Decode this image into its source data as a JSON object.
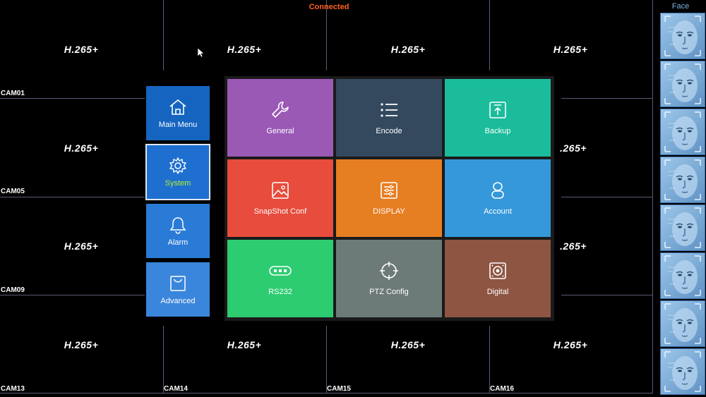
{
  "status": {
    "connection": "Connected"
  },
  "codec_label": "H.265+",
  "codec_label_partial": ".265+",
  "cameras": [
    "CAM01",
    "CAM05",
    "CAM09",
    "CAM13",
    "CAM14",
    "CAM15",
    "CAM16"
  ],
  "face_panel": {
    "title": "Face"
  },
  "side_menu": [
    {
      "label": "Main Menu",
      "icon": "home-icon"
    },
    {
      "label": "System",
      "icon": "gear-icon",
      "active": true
    },
    {
      "label": "Alarm",
      "icon": "bell-icon"
    },
    {
      "label": "Advanced",
      "icon": "bag-icon"
    }
  ],
  "tiles": [
    {
      "label": "General",
      "icon": "wrench-icon",
      "color": "#9b59b6"
    },
    {
      "label": "Encode",
      "icon": "list-icon",
      "color": "#34495e"
    },
    {
      "label": "Backup",
      "icon": "upload-icon",
      "color": "#1abc9c"
    },
    {
      "label": "SnapShot Conf",
      "icon": "image-icon",
      "color": "#e74c3c"
    },
    {
      "label": "DISPLAY",
      "icon": "sliders-icon",
      "color": "#e67e22"
    },
    {
      "label": "Account",
      "icon": "user-icon",
      "color": "#3498db"
    },
    {
      "label": "RS232",
      "icon": "serial-port-icon",
      "color": "#2ecc71"
    },
    {
      "label": "PTZ Config",
      "icon": "crosshair-icon",
      "color": "#6d7b78"
    },
    {
      "label": "Digital",
      "icon": "hdd-icon",
      "color": "#8e5543"
    }
  ],
  "colors": {
    "side_main_menu": "#1565c0",
    "side_system": "#1e6fd0",
    "side_alarm": "#2a7bd6",
    "side_advanced": "#3a86dc",
    "status_text": "#ff6020",
    "active_label": "#b7f02a"
  }
}
